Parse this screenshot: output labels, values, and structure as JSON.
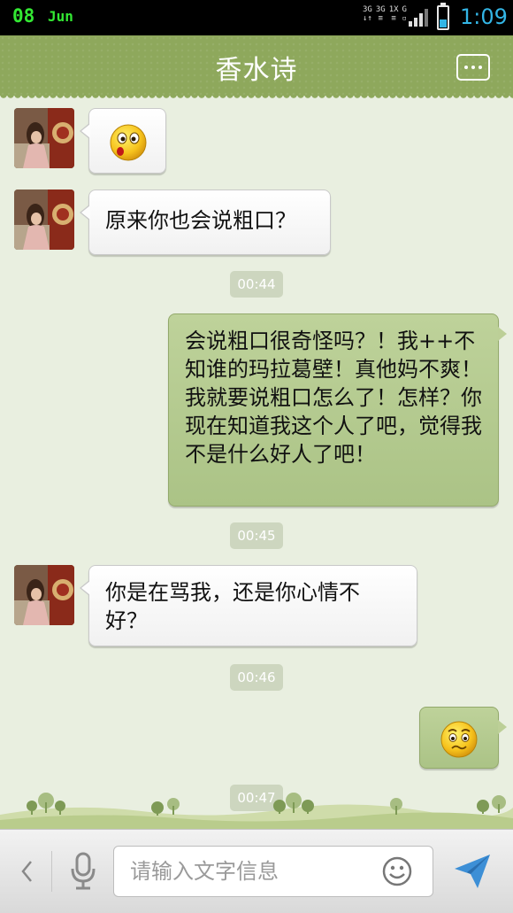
{
  "status_bar": {
    "date": "08",
    "month": "Jun",
    "net_labels": [
      "3G",
      "3G",
      "1X",
      "G"
    ],
    "time": "1:09",
    "battery_level_percent": 40
  },
  "header": {
    "title": "香水诗"
  },
  "messages": {
    "m1": {
      "emoji": "surprised-emoji"
    },
    "m2": {
      "text": "原来你也会说粗口？"
    },
    "t1": "00:44",
    "m3": {
      "text": "会说粗口很奇怪吗？！我++不知谁的玛拉葛壁！真他妈不爽！我就要说粗口怎么了！怎样？你现在知道我这个人了吧，觉得我不是什么好人了吧！"
    },
    "t2": "00:45",
    "m4": {
      "text": "你是在骂我，还是你心情不好？"
    },
    "t3": "00:46",
    "m5": {
      "emoji": "worried-emoji"
    },
    "t4": "00:47"
  },
  "input_bar": {
    "placeholder": "请输入文字信息",
    "value": ""
  },
  "colors": {
    "title_bar": "#8ea85c",
    "chat_background": "#e9efe0",
    "outgoing_bubble": "#b5cb90",
    "incoming_bubble": "#ffffff",
    "clock": "#33b5e5",
    "date": "#33e833"
  },
  "icons": [
    "back-chevron-icon",
    "microphone-icon",
    "smiley-icon",
    "send-arrow-icon",
    "more-icon",
    "signal-icon",
    "battery-icon"
  ]
}
